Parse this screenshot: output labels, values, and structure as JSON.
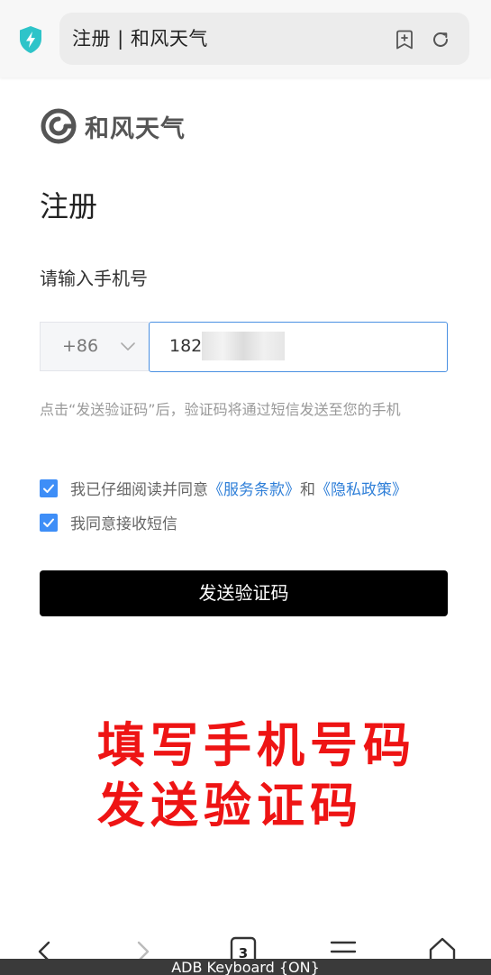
{
  "browser": {
    "url_title": "注册 | 和风天气",
    "tab_count": "3"
  },
  "page": {
    "logo_text": "和风天气",
    "title": "注册",
    "subtitle": "请输入手机号",
    "country_code": "+86",
    "phone_value": "1825",
    "hint": "点击“发送验证码”后，验证码将通过短信发送至您的手机",
    "agree_prefix": "我已仔细阅读并同意",
    "terms_link": "《服务条款》",
    "agree_and": "和",
    "privacy_link": "《隐私政策》",
    "sms_consent": "我同意接收短信",
    "send_button": "发送验证码",
    "agree_checked": true,
    "sms_checked": true
  },
  "annotation": {
    "line1": "填写手机号码",
    "line2": "发送验证码"
  },
  "keyboard_status": "ADB Keyboard {ON}",
  "colors": {
    "accent": "#3e8ef7",
    "link": "#2f7fd8",
    "annotation_red": "#ee1414",
    "shield": "#2ec4c9",
    "button": "#000000"
  }
}
